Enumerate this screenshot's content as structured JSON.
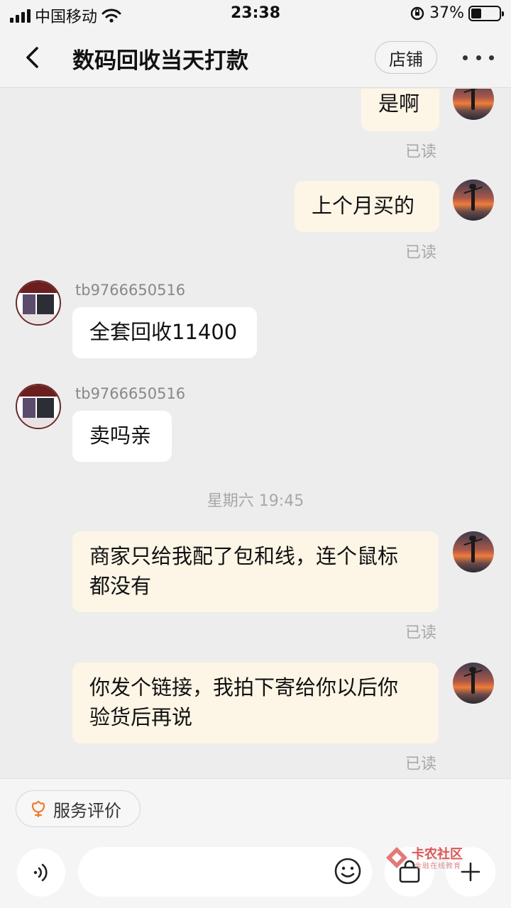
{
  "status_bar": {
    "carrier": "中国移动",
    "time": "23:38",
    "battery": "37%",
    "battery_level": 0.37
  },
  "nav": {
    "title": "数码回收当天打款",
    "shop_label": "店铺"
  },
  "chat": {
    "messages": [
      {
        "side": "mine",
        "text": "是啊",
        "status": "已读"
      },
      {
        "side": "mine",
        "text": "上个月买的",
        "status": "已读"
      },
      {
        "side": "theirs",
        "sender": "tb9766650516",
        "text": "全套回收11400"
      },
      {
        "side": "theirs",
        "sender": "tb9766650516",
        "text": "卖吗亲"
      },
      {
        "type": "timestamp",
        "text": "星期六 19:45"
      },
      {
        "side": "mine",
        "text_lines": [
          "商家只给我配了包和线，连个鼠标",
          "都没有"
        ],
        "status": "已读"
      },
      {
        "side": "mine",
        "text_lines": [
          "你发个链接，我拍下寄给你以后你",
          "验货后再说"
        ],
        "status": "已读"
      }
    ]
  },
  "bottom": {
    "rate_label": "服务评价",
    "input_value": ""
  },
  "watermark": {
    "title": "卡农社区",
    "subtitle": "金融在线教育"
  },
  "icons": {
    "back": "back-arrow-icon",
    "more": "more-dots-icon",
    "voice": "voice-icon",
    "emoji": "emoji-icon",
    "bag": "shopping-bag-icon",
    "plus": "plus-icon",
    "rate": "flower-icon",
    "wifi": "wifi-icon",
    "signal": "signal-icon"
  },
  "colors": {
    "mine_bubble": "#fdf5e6",
    "theirs_bubble": "#ffffff",
    "background": "#ededed",
    "rate_icon": "#f07a2a"
  }
}
